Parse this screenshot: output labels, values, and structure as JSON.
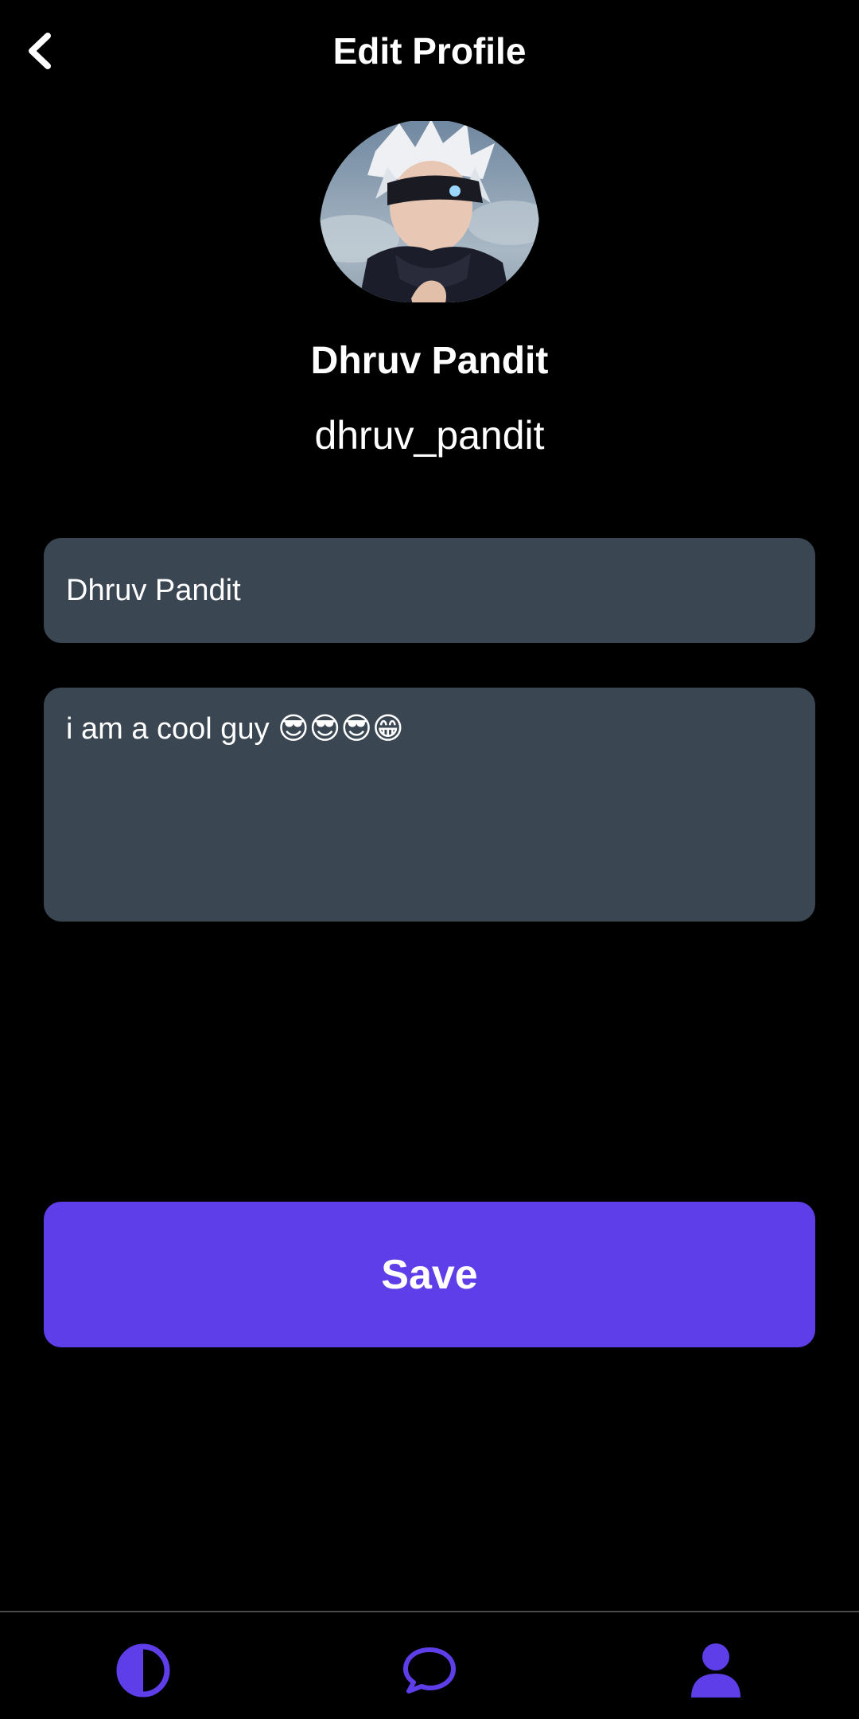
{
  "header": {
    "title": "Edit Profile",
    "back_icon": "chevron-left-icon"
  },
  "profile": {
    "display_name": "Dhruv Pandit",
    "username": "dhruv_pandit"
  },
  "form": {
    "name_value": "Dhruv Pandit",
    "bio_value": "i am a cool guy 😎😎😎😁"
  },
  "actions": {
    "save_label": "Save"
  },
  "bottom_nav": {
    "items": [
      {
        "icon": "theme-toggle-icon"
      },
      {
        "icon": "chat-bubble-icon"
      },
      {
        "icon": "user-profile-icon",
        "active": true
      }
    ]
  },
  "colors": {
    "background": "#000000",
    "field_background": "#3a4651",
    "accent": "#5e3ee8",
    "text": "#ffffff"
  }
}
